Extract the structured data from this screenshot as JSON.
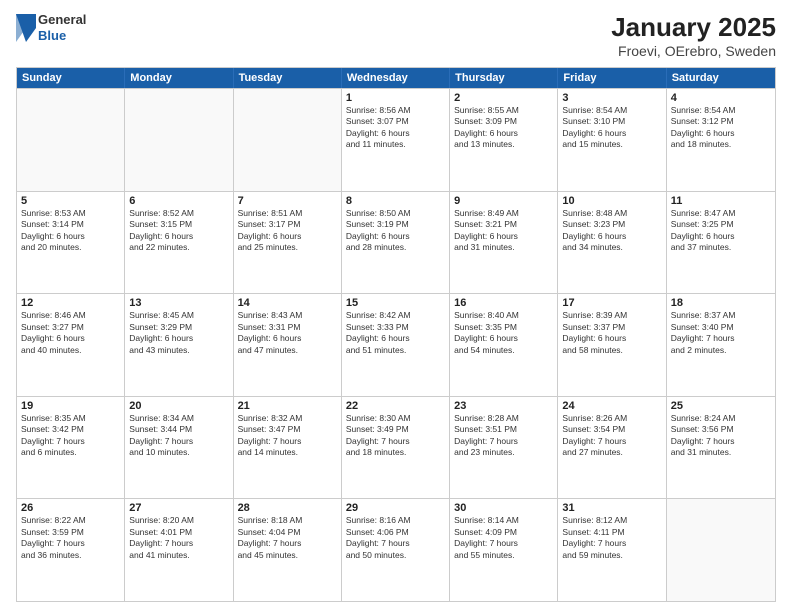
{
  "header": {
    "logo": {
      "line1": "General",
      "line2": "Blue"
    },
    "title": "January 2025",
    "location": "Froevi, OErebro, Sweden"
  },
  "days_of_week": [
    "Sunday",
    "Monday",
    "Tuesday",
    "Wednesday",
    "Thursday",
    "Friday",
    "Saturday"
  ],
  "weeks": [
    [
      {
        "day": "",
        "info": ""
      },
      {
        "day": "",
        "info": ""
      },
      {
        "day": "",
        "info": ""
      },
      {
        "day": "1",
        "info": "Sunrise: 8:56 AM\nSunset: 3:07 PM\nDaylight: 6 hours\nand 11 minutes."
      },
      {
        "day": "2",
        "info": "Sunrise: 8:55 AM\nSunset: 3:09 PM\nDaylight: 6 hours\nand 13 minutes."
      },
      {
        "day": "3",
        "info": "Sunrise: 8:54 AM\nSunset: 3:10 PM\nDaylight: 6 hours\nand 15 minutes."
      },
      {
        "day": "4",
        "info": "Sunrise: 8:54 AM\nSunset: 3:12 PM\nDaylight: 6 hours\nand 18 minutes."
      }
    ],
    [
      {
        "day": "5",
        "info": "Sunrise: 8:53 AM\nSunset: 3:14 PM\nDaylight: 6 hours\nand 20 minutes."
      },
      {
        "day": "6",
        "info": "Sunrise: 8:52 AM\nSunset: 3:15 PM\nDaylight: 6 hours\nand 22 minutes."
      },
      {
        "day": "7",
        "info": "Sunrise: 8:51 AM\nSunset: 3:17 PM\nDaylight: 6 hours\nand 25 minutes."
      },
      {
        "day": "8",
        "info": "Sunrise: 8:50 AM\nSunset: 3:19 PM\nDaylight: 6 hours\nand 28 minutes."
      },
      {
        "day": "9",
        "info": "Sunrise: 8:49 AM\nSunset: 3:21 PM\nDaylight: 6 hours\nand 31 minutes."
      },
      {
        "day": "10",
        "info": "Sunrise: 8:48 AM\nSunset: 3:23 PM\nDaylight: 6 hours\nand 34 minutes."
      },
      {
        "day": "11",
        "info": "Sunrise: 8:47 AM\nSunset: 3:25 PM\nDaylight: 6 hours\nand 37 minutes."
      }
    ],
    [
      {
        "day": "12",
        "info": "Sunrise: 8:46 AM\nSunset: 3:27 PM\nDaylight: 6 hours\nand 40 minutes."
      },
      {
        "day": "13",
        "info": "Sunrise: 8:45 AM\nSunset: 3:29 PM\nDaylight: 6 hours\nand 43 minutes."
      },
      {
        "day": "14",
        "info": "Sunrise: 8:43 AM\nSunset: 3:31 PM\nDaylight: 6 hours\nand 47 minutes."
      },
      {
        "day": "15",
        "info": "Sunrise: 8:42 AM\nSunset: 3:33 PM\nDaylight: 6 hours\nand 51 minutes."
      },
      {
        "day": "16",
        "info": "Sunrise: 8:40 AM\nSunset: 3:35 PM\nDaylight: 6 hours\nand 54 minutes."
      },
      {
        "day": "17",
        "info": "Sunrise: 8:39 AM\nSunset: 3:37 PM\nDaylight: 6 hours\nand 58 minutes."
      },
      {
        "day": "18",
        "info": "Sunrise: 8:37 AM\nSunset: 3:40 PM\nDaylight: 7 hours\nand 2 minutes."
      }
    ],
    [
      {
        "day": "19",
        "info": "Sunrise: 8:35 AM\nSunset: 3:42 PM\nDaylight: 7 hours\nand 6 minutes."
      },
      {
        "day": "20",
        "info": "Sunrise: 8:34 AM\nSunset: 3:44 PM\nDaylight: 7 hours\nand 10 minutes."
      },
      {
        "day": "21",
        "info": "Sunrise: 8:32 AM\nSunset: 3:47 PM\nDaylight: 7 hours\nand 14 minutes."
      },
      {
        "day": "22",
        "info": "Sunrise: 8:30 AM\nSunset: 3:49 PM\nDaylight: 7 hours\nand 18 minutes."
      },
      {
        "day": "23",
        "info": "Sunrise: 8:28 AM\nSunset: 3:51 PM\nDaylight: 7 hours\nand 23 minutes."
      },
      {
        "day": "24",
        "info": "Sunrise: 8:26 AM\nSunset: 3:54 PM\nDaylight: 7 hours\nand 27 minutes."
      },
      {
        "day": "25",
        "info": "Sunrise: 8:24 AM\nSunset: 3:56 PM\nDaylight: 7 hours\nand 31 minutes."
      }
    ],
    [
      {
        "day": "26",
        "info": "Sunrise: 8:22 AM\nSunset: 3:59 PM\nDaylight: 7 hours\nand 36 minutes."
      },
      {
        "day": "27",
        "info": "Sunrise: 8:20 AM\nSunset: 4:01 PM\nDaylight: 7 hours\nand 41 minutes."
      },
      {
        "day": "28",
        "info": "Sunrise: 8:18 AM\nSunset: 4:04 PM\nDaylight: 7 hours\nand 45 minutes."
      },
      {
        "day": "29",
        "info": "Sunrise: 8:16 AM\nSunset: 4:06 PM\nDaylight: 7 hours\nand 50 minutes."
      },
      {
        "day": "30",
        "info": "Sunrise: 8:14 AM\nSunset: 4:09 PM\nDaylight: 7 hours\nand 55 minutes."
      },
      {
        "day": "31",
        "info": "Sunrise: 8:12 AM\nSunset: 4:11 PM\nDaylight: 7 hours\nand 59 minutes."
      },
      {
        "day": "",
        "info": ""
      }
    ]
  ]
}
